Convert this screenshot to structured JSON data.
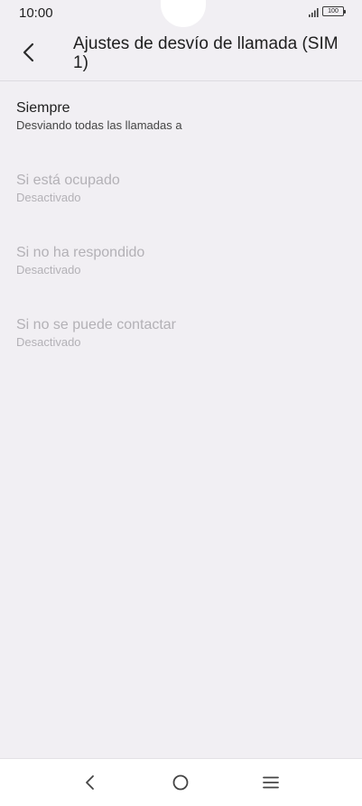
{
  "status_bar": {
    "time": "10:00",
    "battery": "100",
    "icons": [
      "signal-icon",
      "battery-icon"
    ]
  },
  "header": {
    "back_icon": "chevron-left-icon",
    "title_line1": "Ajustes de desvío de llamada (SIM",
    "title_line2": "1)"
  },
  "forwarding_options": [
    {
      "title": "Siempre",
      "subtitle": "Desviando todas las llamadas a",
      "enabled": true
    },
    {
      "title": "Si está ocupado",
      "subtitle": "Desactivado",
      "enabled": false
    },
    {
      "title": "Si no ha respondido",
      "subtitle": "Desactivado",
      "enabled": false
    },
    {
      "title": "Si no se puede contactar",
      "subtitle": "Desactivado",
      "enabled": false
    }
  ],
  "nav_bar": {
    "icons": [
      "back-icon",
      "home-icon",
      "recents-menu-icon"
    ]
  },
  "colors": {
    "background": "#f1eff3",
    "text_primary": "#1f1f1f",
    "text_disabled": "#b3b1b6",
    "nav_background": "#ffffff"
  }
}
